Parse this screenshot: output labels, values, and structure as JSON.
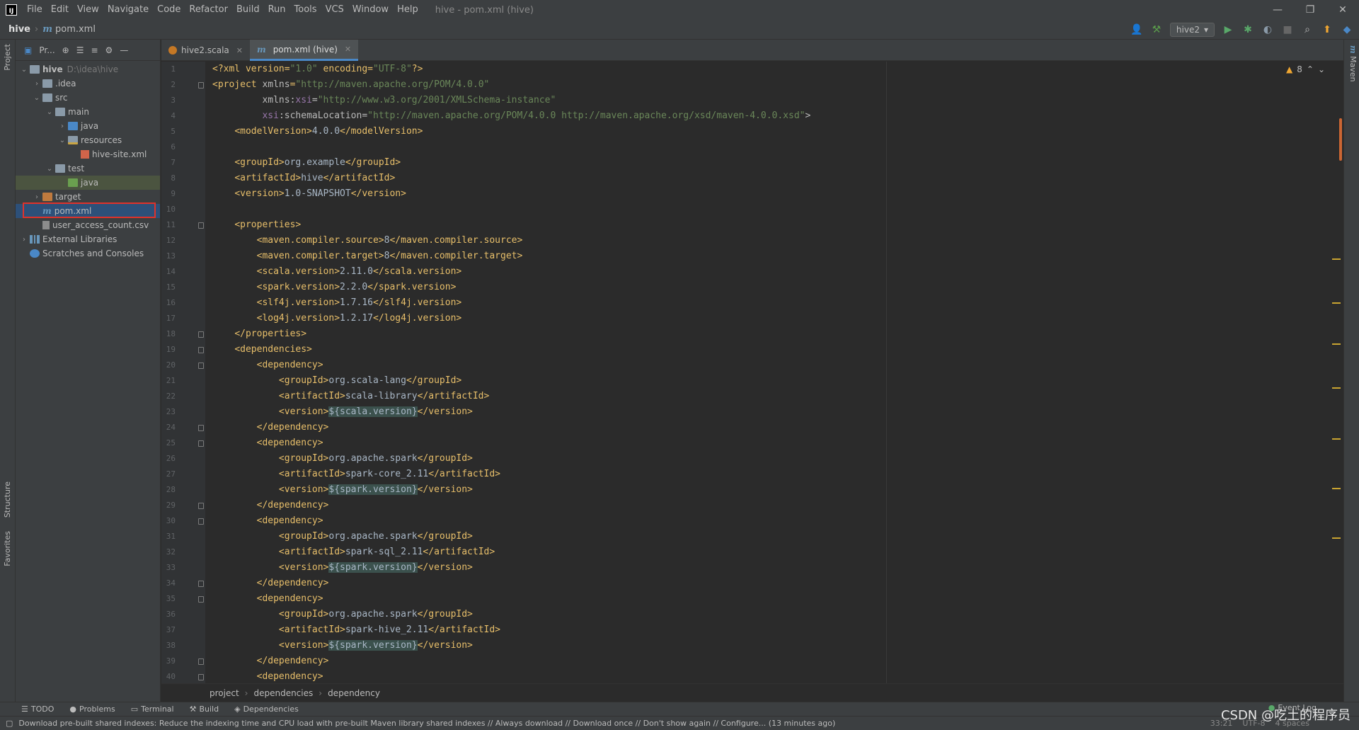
{
  "app": {
    "logo": "IJ",
    "window_title": "hive - pom.xml (hive)",
    "menu": [
      "File",
      "Edit",
      "View",
      "Navigate",
      "Code",
      "Refactor",
      "Build",
      "Run",
      "Tools",
      "VCS",
      "Window",
      "Help"
    ]
  },
  "navbar": {
    "project": "hive",
    "file": "pom.xml",
    "run_config": "hive2"
  },
  "project_panel": {
    "title": "Pr...",
    "tree": [
      {
        "label": "hive",
        "path": "D:\\idea\\hive",
        "depth": 0,
        "arrow": "v",
        "icon": "folder"
      },
      {
        "label": ".idea",
        "depth": 1,
        "arrow": ">",
        "icon": "folder"
      },
      {
        "label": "src",
        "depth": 1,
        "arrow": "v",
        "icon": "folder"
      },
      {
        "label": "main",
        "depth": 2,
        "arrow": "v",
        "icon": "folder"
      },
      {
        "label": "java",
        "depth": 3,
        "arrow": ">",
        "icon": "folder-blue"
      },
      {
        "label": "resources",
        "depth": 3,
        "arrow": "v",
        "icon": "folder-res"
      },
      {
        "label": "hive-site.xml",
        "depth": 4,
        "arrow": "",
        "icon": "xml"
      },
      {
        "label": "test",
        "depth": 2,
        "arrow": "v",
        "icon": "folder"
      },
      {
        "label": "java",
        "depth": 3,
        "arrow": "",
        "icon": "folder-green"
      },
      {
        "label": "target",
        "depth": 1,
        "arrow": ">",
        "icon": "folder-orange"
      },
      {
        "label": "pom.xml",
        "depth": 1,
        "arrow": "",
        "icon": "maven"
      },
      {
        "label": "user_access_count.csv",
        "depth": 1,
        "arrow": "",
        "icon": "csv"
      },
      {
        "label": "External Libraries",
        "depth": 0,
        "arrow": ">",
        "icon": "lib"
      },
      {
        "label": "Scratches and Consoles",
        "depth": 0,
        "arrow": "",
        "icon": "scratch"
      }
    ]
  },
  "tabs": [
    {
      "label": "hive2.scala",
      "icon": "scala",
      "active": false
    },
    {
      "label": "pom.xml (hive)",
      "icon": "maven",
      "active": true
    }
  ],
  "left_strip": {
    "project": "Project",
    "structure": "Structure",
    "favorites": "Favorites"
  },
  "right_strip": {
    "maven": "Maven"
  },
  "editor": {
    "warning_count": "8",
    "lines": [
      "<?xml version=\"1.0\" encoding=\"UTF-8\"?>",
      "<project xmlns=\"http://maven.apache.org/POM/4.0.0\"",
      "         xmlns:xsi=\"http://www.w3.org/2001/XMLSchema-instance\"",
      "         xsi:schemaLocation=\"http://maven.apache.org/POM/4.0.0 http://maven.apache.org/xsd/maven-4.0.0.xsd\">",
      "    <modelVersion>4.0.0</modelVersion>",
      "",
      "    <groupId>org.example</groupId>",
      "    <artifactId>hive</artifactId>",
      "    <version>1.0-SNAPSHOT</version>",
      "",
      "    <properties>",
      "        <maven.compiler.source>8</maven.compiler.source>",
      "        <maven.compiler.target>8</maven.compiler.target>",
      "        <scala.version>2.11.0</scala.version>",
      "        <spark.version>2.2.0</spark.version>",
      "        <slf4j.version>1.7.16</slf4j.version>",
      "        <log4j.version>1.2.17</log4j.version>",
      "    </properties>",
      "    <dependencies>",
      "        <dependency>",
      "            <groupId>org.scala-lang</groupId>",
      "            <artifactId>scala-library</artifactId>",
      "            <version>${scala.version}</version>",
      "        </dependency>",
      "        <dependency>",
      "            <groupId>org.apache.spark</groupId>",
      "            <artifactId>spark-core_2.11</artifactId>",
      "            <version>${spark.version}</version>",
      "        </dependency>",
      "        <dependency>",
      "            <groupId>org.apache.spark</groupId>",
      "            <artifactId>spark-sql_2.11</artifactId>",
      "            <version>${spark.version}</version>",
      "        </dependency>",
      "        <dependency>",
      "            <groupId>org.apache.spark</groupId>",
      "            <artifactId>spark-hive_2.11</artifactId>",
      "            <version>${spark.version}</version>",
      "        </dependency>",
      "        <dependency>"
    ],
    "fold_lines": [
      2,
      11,
      18,
      19,
      20,
      24,
      25,
      29,
      30,
      34,
      35,
      39,
      40
    ]
  },
  "breadcrumbs": [
    "project",
    "dependencies",
    "dependency"
  ],
  "bottom_tools": [
    "TODO",
    "Problems",
    "Terminal",
    "Build",
    "Dependencies"
  ],
  "event_log": "Event Log",
  "status": {
    "message": "Download pre-built shared indexes: Reduce the indexing time and CPU load with pre-built Maven library shared indexes // Always download // Download once // Don't show again // Configure... (13 minutes ago)",
    "position": "33:21",
    "encoding": "UTF-8",
    "indent": "4 spaces"
  },
  "watermark": "CSDN @吃土的程序员",
  "colors": {
    "accent": "#4a88c7",
    "tag": "#e8bf6a",
    "string": "#6a8759",
    "highlight_box": "#e0322a"
  }
}
